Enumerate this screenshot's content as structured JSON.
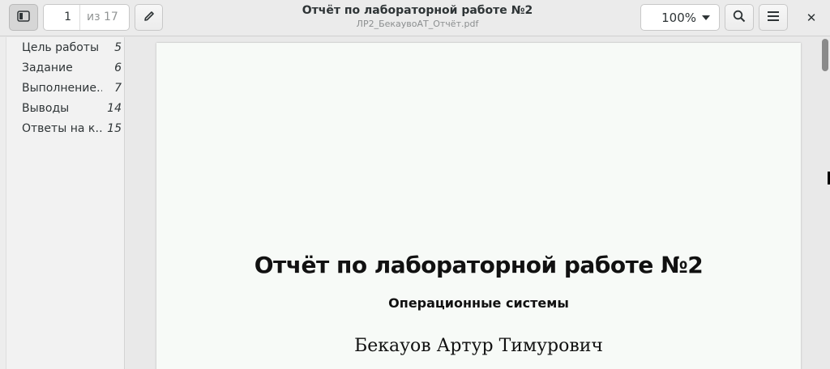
{
  "header": {
    "sidebar_toggle_icon": "sidebar-toggle-icon",
    "page_current": "1",
    "page_total": "из 17",
    "annotate_icon": "pencil-icon",
    "title": "Отчёт по лабораторной работе №2",
    "filename": "ЛР2_БекаувоАТ_Отчёт.pdf",
    "zoom": "100%",
    "search_icon": "search-icon",
    "menu_icon": "hamburger-menu-icon",
    "close_label": "✕"
  },
  "sidebar": {
    "items": [
      {
        "label": "Цель работы",
        "page": "5"
      },
      {
        "label": "Задание",
        "page": "6"
      },
      {
        "label": "Выполнение…",
        "page": "7"
      },
      {
        "label": "Выводы",
        "page": "14"
      },
      {
        "label": "Ответы на к…",
        "page": "15"
      }
    ]
  },
  "document": {
    "title": "Отчёт по лабораторной работе №2",
    "subtitle": "Операционные системы",
    "author": "Бекауов Артур Тимурович"
  }
}
